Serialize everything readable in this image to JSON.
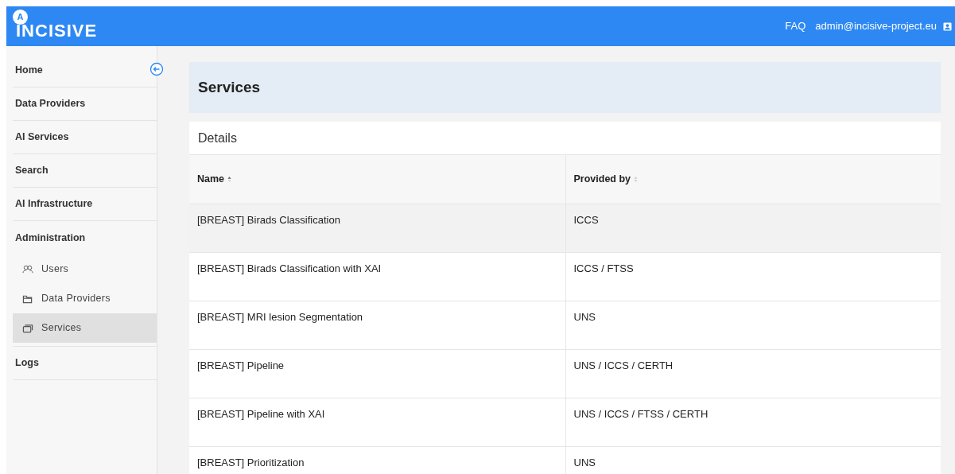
{
  "header": {
    "logo": {
      "badge": "A",
      "text": "INCISIVE"
    },
    "links": [
      "FAQ",
      "admin@incisive-project.eu"
    ]
  },
  "sidebar": {
    "items": [
      {
        "label": "Home",
        "selected": false
      },
      {
        "label": "Data Providers",
        "selected": false
      },
      {
        "label": "AI Services",
        "selected": false
      },
      {
        "label": "Search",
        "selected": false
      },
      {
        "label": "AI Infrastructure",
        "selected": false
      },
      {
        "label": "Administration",
        "selected": false,
        "expanded": true,
        "children": [
          {
            "label": "Users",
            "kind": "users",
            "selected": false
          },
          {
            "label": "Data Providers",
            "kind": "folder",
            "selected": false
          },
          {
            "label": "Services",
            "kind": "stack",
            "selected": true
          }
        ]
      },
      {
        "label": "Logs",
        "selected": false
      }
    ]
  },
  "page": {
    "title": "Services",
    "card_title": "Details"
  },
  "table": {
    "columns": [
      {
        "label": "Name",
        "sorted": true
      },
      {
        "label": "Provided by",
        "sorted": false
      }
    ],
    "rows": [
      {
        "cells": [
          "[BREAST] Birads Classification",
          "ICCS"
        ],
        "selected": true
      },
      {
        "cells": [
          "[BREAST] Birads Classification with XAI",
          "ICCS / FTSS"
        ],
        "selected": false
      },
      {
        "cells": [
          "[BREAST] MRI lesion Segmentation",
          "UNS"
        ],
        "selected": false
      },
      {
        "cells": [
          "[BREAST] Pipeline",
          "UNS / ICCS / CERTH"
        ],
        "selected": false
      },
      {
        "cells": [
          "[BREAST] Pipeline with XAI",
          "UNS / ICCS / FTSS / CERTH"
        ],
        "selected": false
      },
      {
        "cells": [
          "[BREAST] Prioritization",
          "UNS"
        ],
        "selected": false
      }
    ]
  }
}
